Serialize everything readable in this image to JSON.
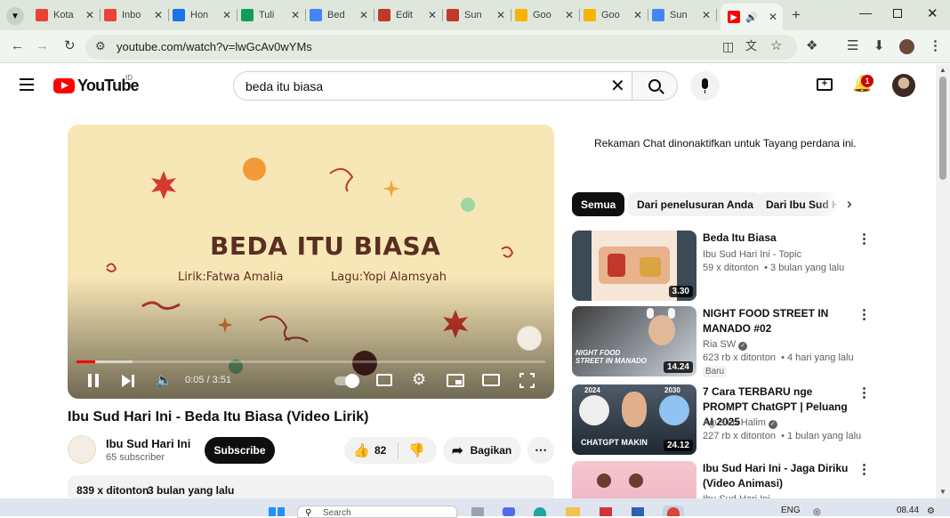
{
  "tabs": [
    {
      "label": "Kota",
      "icon": "gmail-icon",
      "color": "#ea4335"
    },
    {
      "label": "Inbo",
      "icon": "gmail-icon",
      "color": "#ea4335"
    },
    {
      "label": "Hon",
      "icon": "drive-icon",
      "color": "#1a73e8"
    },
    {
      "label": "Tuli",
      "icon": "sheets-icon",
      "color": "#0f9d58"
    },
    {
      "label": "Bed",
      "icon": "docs-icon",
      "color": "#4285f4"
    },
    {
      "label": "Edit",
      "icon": "channel-icon",
      "color": "#c0392b"
    },
    {
      "label": "Sun",
      "icon": "channel-icon",
      "color": "#c0392b"
    },
    {
      "label": "Goo",
      "icon": "keep-icon",
      "color": "#f4b400"
    },
    {
      "label": "Goo",
      "icon": "keep-icon",
      "color": "#f4b400"
    },
    {
      "label": "Sun",
      "icon": "google-icon",
      "color": "#4285f4"
    }
  ],
  "browser": {
    "url": "youtube.com/watch?v=lwGcAv0wYMs"
  },
  "header": {
    "logo_text": "YouTube",
    "country": "ID",
    "search_value": "beda itu biasa",
    "notif_count": "1"
  },
  "player": {
    "title_art": "BEDA ITU BIASA",
    "lyricist": "Lirik:Fatwa Amalia",
    "composer": "Lagu:Yopi Alamsyah",
    "time": "0:05 / 3:51",
    "progress": 0.02,
    "buffered": 0.12
  },
  "video": {
    "title": "Ibu Sud Hari Ini - Beda Itu Biasa (Video Lirik)",
    "channel": "Ibu Sud Hari Ini",
    "subscribers": "65 subscriber",
    "subscribe_label": "Subscribe",
    "likes": "82",
    "share_label": "Bagikan",
    "views": "839 x ditonton",
    "date": "3 bulan yang lalu"
  },
  "chat": {
    "notice": "Rekaman Chat dinonaktifkan untuk Tayang perdana ini."
  },
  "chips": [
    "Semua",
    "Dari penelusuran Anda",
    "Dari Ibu Sud Hari Ini"
  ],
  "recommendations": [
    {
      "title": "Beda Itu Biasa",
      "channel": "Ibu Sud Hari Ini - Topic",
      "views": "59 x ditonton",
      "age": "3 bulan yang lalu",
      "duration": "3.30",
      "badge": ""
    },
    {
      "title": "NIGHT FOOD STREET IN MANADO #02",
      "channel": "Ria SW",
      "views": "623 rb x ditonton",
      "age": "4 hari yang lalu",
      "duration": "14.24",
      "badge": "Baru"
    },
    {
      "title": "7 Cara TERBARU nge PROMPT ChatGPT | Peluang AI 2025",
      "channel": "Agusleo Halim",
      "views": "227 rb x ditonton",
      "age": "1 bulan yang lalu",
      "duration": "24.12",
      "badge": ""
    },
    {
      "title": "Ibu Sud Hari Ini - Jaga Diriku (Video Animasi)",
      "channel": "Ibu Sud Hari Ini",
      "views": "",
      "age": "",
      "duration": "",
      "badge": ""
    }
  ],
  "thumb_text": {
    "food": "NIGHT FOOD STREET IN MANADO",
    "chatgpt": "CHATGPT MAKIN",
    "year_a": "2024",
    "year_b": "2030"
  },
  "taskbar": {
    "search_placeholder": "Search",
    "lang": "ENG",
    "time": "08.44"
  }
}
